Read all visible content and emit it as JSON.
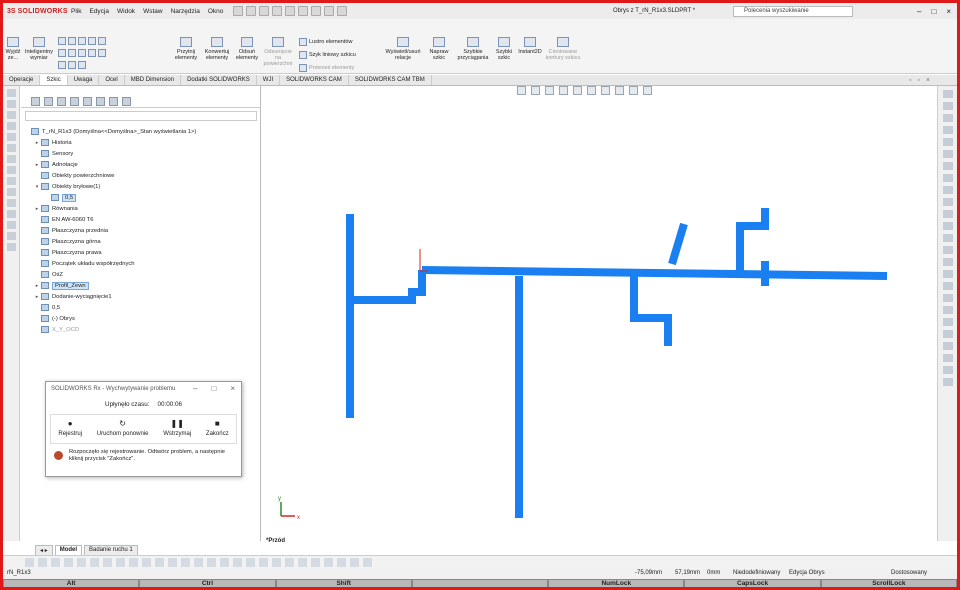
{
  "app": {
    "brand_ds": "3S",
    "brand_sw": "SOLIDWORKS",
    "doc_title": "Obrys z T_rN_R1x3.SLDPRT *",
    "search_placeholder": "Polecenia wyszukiwanie"
  },
  "menu": [
    "Plik",
    "Edycja",
    "Widok",
    "Wstaw",
    "Narzędzia",
    "Okno"
  ],
  "command": {
    "exit_sketch": "Wyjdź ze...",
    "smart_dim": "Inteligentny wymiar",
    "trim": "Przytnij elementy",
    "convert": "Konwertuj elementy",
    "offset": "Odsuń elementy",
    "offset_surface": "Odsunięcie na powierzchni",
    "mirror": "Lustro elementów",
    "linear_pattern": "Szyk liniowy szkicu",
    "move": "Przenieś elementy",
    "relations": "Wyświetl/usuń relacje",
    "repair": "Napraw szkic",
    "quick_snaps": "Szybkie przyciągania",
    "rapid_sketch": "Szybki szkic",
    "instant2d": "Instant2D",
    "shaded_contours": "Cieniowane kontury szkicu"
  },
  "tabs": [
    "Operacje",
    "Szkic",
    "Uwaga",
    "Ocel",
    "MBD Dimension",
    "Dodatki SOLIDWORKS",
    "WJI",
    "SOLIDWORKS CAM",
    "SOLIDWORKS CAM TBM"
  ],
  "active_tab": "Szkic",
  "tree": [
    {
      "label": "T_rN_R1x3 (Domyślna<<Domyślna>_Stan wyświetlania 1>)",
      "arrow": "",
      "indent": 0
    },
    {
      "label": "Historia",
      "arrow": "▸",
      "indent": 1
    },
    {
      "label": "Sensory",
      "arrow": "",
      "indent": 1
    },
    {
      "label": "Adnotacje",
      "arrow": "▸",
      "indent": 1
    },
    {
      "label": "Obiekty powierzchniowe",
      "arrow": "",
      "indent": 1
    },
    {
      "label": "Obiekty bryłowe(1)",
      "arrow": "▾",
      "indent": 1
    },
    {
      "label": "0,5",
      "arrow": "",
      "indent": 2,
      "selected": true
    },
    {
      "label": "Równania",
      "arrow": "▸",
      "indent": 1
    },
    {
      "label": "EN AW-6060 T6",
      "arrow": "",
      "indent": 1
    },
    {
      "label": "Płaszczyzna przednia",
      "arrow": "",
      "indent": 1
    },
    {
      "label": "Płaszczyzna górna",
      "arrow": "",
      "indent": 1
    },
    {
      "label": "Płaszczyzna prawa",
      "arrow": "",
      "indent": 1
    },
    {
      "label": "Początek układu współrzędnych",
      "arrow": "",
      "indent": 1
    },
    {
      "label": "OśZ",
      "arrow": "",
      "indent": 1
    },
    {
      "label": "Profil_Zewn",
      "arrow": "▸",
      "indent": 1,
      "selected": true
    },
    {
      "label": "Dodanie-wyciągnięcie1",
      "arrow": "▸",
      "indent": 1
    },
    {
      "label": "0,5",
      "arrow": "",
      "indent": 1
    },
    {
      "label": "(-) Obrys",
      "arrow": "",
      "indent": 1
    },
    {
      "label": "X_Y_OCD",
      "arrow": "",
      "indent": 1,
      "dim": true
    }
  ],
  "dialog": {
    "title": "SOLIDWORKS Rx - Wychwytywanie problemu",
    "elapsed_label": "Upłynęło czasu:",
    "elapsed_value": "00:00:06",
    "buttons": [
      {
        "label": "Rejestruj",
        "glyph": "●"
      },
      {
        "label": "Uruchom ponownie",
        "glyph": "↻"
      },
      {
        "label": "Wstrzymaj",
        "glyph": "❚❚"
      },
      {
        "label": "Zakończ",
        "glyph": "■"
      }
    ],
    "message": "Rozpoczęło się rejestrowanie. Odtwórz problem, a następnie kliknij przycisk \"Zakończ\"."
  },
  "viewport": {
    "view_label": "*Przód",
    "profile_color": "#1a7ff0"
  },
  "model_tabs": [
    "Model",
    "Badanie ruchu 1"
  ],
  "status": {
    "file": "rN_R1x3",
    "x": "-75,09mm",
    "y": "57,19mm",
    "z": "0mm",
    "state": "Niedodefiniowany",
    "mode": "Edycja Obrys",
    "custom": "Dostosowany"
  },
  "keys": [
    "Alt",
    "Ctrl",
    "Shift",
    "",
    "NumLock",
    "CapsLock",
    "ScrollLock"
  ]
}
